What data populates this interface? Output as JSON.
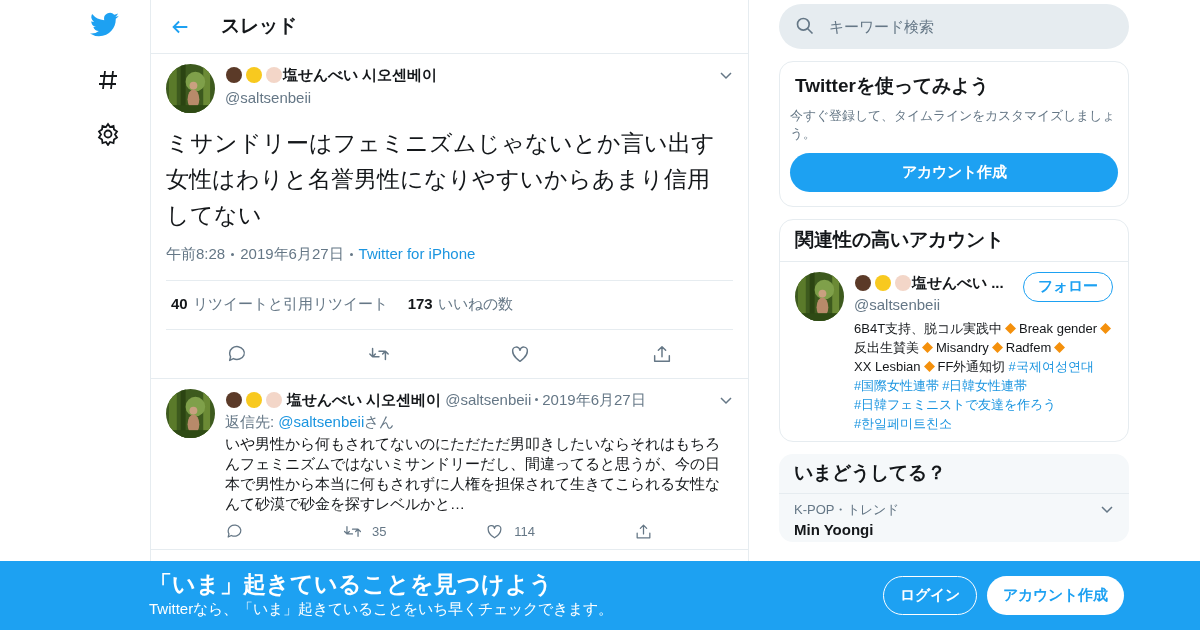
{
  "header": {
    "title": "スレッド"
  },
  "search": {
    "placeholder": "キーワード検索"
  },
  "main_tweet": {
    "name": "塩せんべい 시오센베이",
    "handle": "@saltsenbeii",
    "text": "ミサンドリーはフェミニズムじゃないとか言い出す女性はわりと名誉男性になりやすいからあまり信用してない",
    "time": "午前8:28",
    "date": "2019年6月27日",
    "source": "Twitter for iPhone",
    "retweets": "40",
    "retweets_label": "リツイートと引用リツイート",
    "likes": "173",
    "likes_label": "いいねの数"
  },
  "reply": {
    "name": "塩せんべい 시오센베이",
    "handle": "@saltsenbeii",
    "date": "2019年6月27日",
    "reply_to_label": "返信先:",
    "reply_to": "@saltsenbeii",
    "reply_to_suffix": "さん",
    "text": "いや男性から何もされてないのにただただ男叩きしたいならそれはもちろんフェミニズムではないミサンドリーだし、間違ってると思うが、今の日本で男性から本当に何もされずに人権を担保されて生きてこられる女性なんて砂漠で砂金を探すレベルかと…",
    "retweets": "35",
    "likes": "114"
  },
  "signup_card": {
    "title": "Twitterを使ってみよう",
    "text": "今すぐ登録して、タイムラインをカスタマイズしましょう。",
    "button": "アカウント作成"
  },
  "related": {
    "title": "関連性の高いアカウント",
    "name": "塩せんべい ...",
    "handle": "@saltsenbeii",
    "follow": "フォロー",
    "bio": [
      {
        "kind": "text",
        "text": "6B4T支持、脱コル実践中"
      },
      {
        "kind": "diamond"
      },
      {
        "kind": "text",
        "text": "Break gender"
      },
      {
        "kind": "diamond"
      },
      {
        "kind": "text",
        "text": "反出生賛美"
      },
      {
        "kind": "diamond"
      },
      {
        "kind": "text",
        "text": "Misandry"
      },
      {
        "kind": "diamond"
      },
      {
        "kind": "text",
        "text": "Radfem"
      },
      {
        "kind": "diamond"
      },
      {
        "kind": "text",
        "text": "XX Lesbian"
      },
      {
        "kind": "diamond"
      },
      {
        "kind": "text",
        "text": "FF外通知切"
      },
      {
        "kind": "hashtag",
        "text": "#국제여성연대"
      },
      {
        "kind": "hashtag",
        "text": "#国際女性連帯"
      },
      {
        "kind": "hashtag",
        "text": "#日韓女性連帯"
      },
      {
        "kind": "hashtag",
        "text": "#日韓フェミニストで友達を作ろう"
      },
      {
        "kind": "hashtag",
        "text": "#한일페미트친소"
      }
    ]
  },
  "trends": {
    "title": "いまどうしてる？",
    "items": [
      {
        "context": "K-POP・トレンド",
        "name": "Min Yoongi"
      }
    ]
  },
  "banner": {
    "title": "「いま」起きていることを見つけよう",
    "subtitle": "Twitterなら、「いま」起きていることをいち早くチェックできます。",
    "login": "ログイン",
    "signup": "アカウント作成"
  }
}
